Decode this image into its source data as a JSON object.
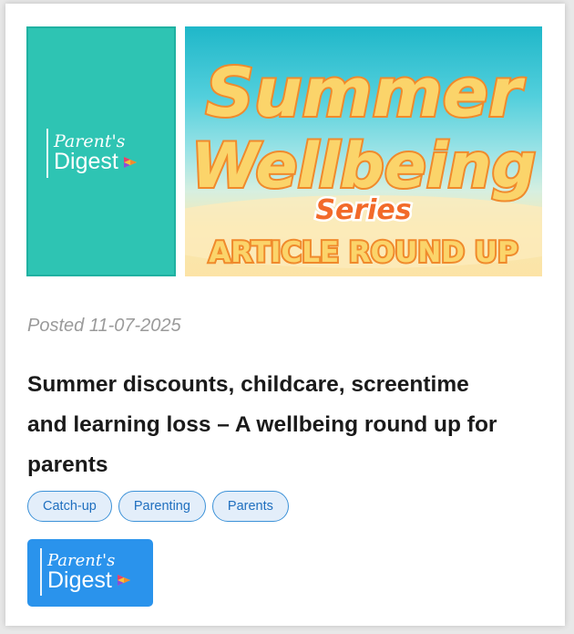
{
  "hero": {
    "brand": {
      "line1": "Parent's",
      "line2": "Digest"
    },
    "headline": {
      "word1": "Summer",
      "word2": "Wellbeing",
      "word3": "Series",
      "subtitle": "ARTICLE ROUND UP"
    }
  },
  "post": {
    "posted": "Posted 11-07-2025",
    "title_line1": "Summer discounts, childcare, screentime",
    "title_line2": "and learning loss – A wellbeing round up for",
    "title_line3": "parents"
  },
  "tags": [
    {
      "label": "Catch-up"
    },
    {
      "label": "Parenting"
    },
    {
      "label": "Parents"
    }
  ],
  "badge": {
    "line1": "Parent's",
    "line2": "Digest"
  },
  "colors": {
    "teal": "#2ec4b3",
    "headline_fill": "#fbd46a",
    "headline_stroke": "#f08a2c",
    "tag_border": "#3d92d8",
    "badge_blue": "#2a93ec"
  }
}
